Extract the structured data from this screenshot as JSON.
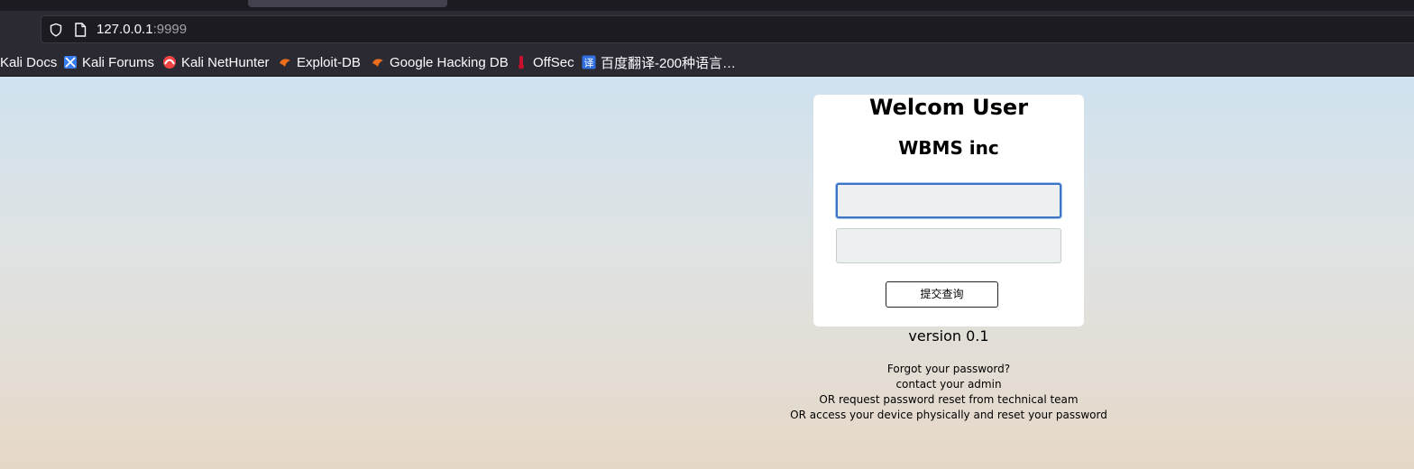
{
  "browser": {
    "url_host": "127.0.0.1",
    "url_port": ":9999"
  },
  "bookmarks": [
    {
      "label": "Kali Docs",
      "icon": "kali-docs-icon"
    },
    {
      "label": "Kali Forums",
      "icon": "kali-forums-icon"
    },
    {
      "label": "Kali NetHunter",
      "icon": "kali-nethunter-icon"
    },
    {
      "label": "Exploit-DB",
      "icon": "exploit-db-icon"
    },
    {
      "label": "Google Hacking DB",
      "icon": "google-hacking-db-icon"
    },
    {
      "label": "OffSec",
      "icon": "offsec-icon"
    },
    {
      "label": "百度翻译-200种语言…",
      "icon": "baidu-translate-icon"
    }
  ],
  "login": {
    "title": "Welcom User",
    "company": "WBMS inc",
    "username_value": "",
    "password_value": "",
    "submit_label": "提交查询"
  },
  "footer": {
    "version": "version 0.1",
    "help_lines": [
      "Forgot your password?",
      "contact your admin",
      "OR request password reset from technical team",
      "OR access your device physically and reset your password"
    ]
  },
  "colors": {
    "accent_focus": "#3b74c7",
    "toolbar_bg": "#2b2a33"
  }
}
